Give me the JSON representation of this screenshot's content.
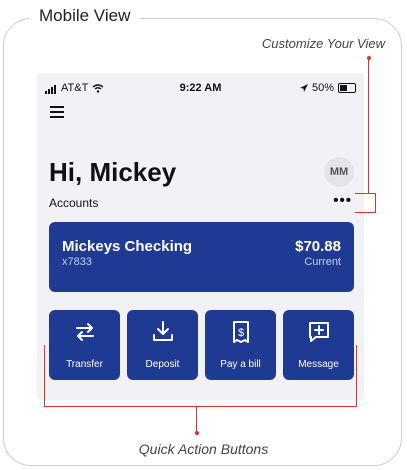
{
  "frame": {
    "title": "Mobile View"
  },
  "callouts": {
    "top": "Customize Your View",
    "bottom": "Quick Action Buttons"
  },
  "status_bar": {
    "carrier": "AT&T",
    "time": "9:22 AM",
    "battery": "50%"
  },
  "header": {
    "greeting": "Hi, Mickey",
    "avatar_initials": "MM"
  },
  "accounts": {
    "label": "Accounts",
    "more": "•••",
    "items": [
      {
        "name": "Mickeys Checking",
        "number": "x7833",
        "balance": "$70.88",
        "status": "Current"
      }
    ]
  },
  "quick_actions": [
    {
      "label": "Transfer",
      "icon": "transfer-icon"
    },
    {
      "label": "Deposit",
      "icon": "deposit-icon"
    },
    {
      "label": "Pay a bill",
      "icon": "pay-bill-icon"
    },
    {
      "label": "Message",
      "icon": "message-icon"
    }
  ],
  "colors": {
    "primary": "#1f3a93",
    "callout": "#d8342f",
    "screen_bg": "#f2f2f6"
  }
}
